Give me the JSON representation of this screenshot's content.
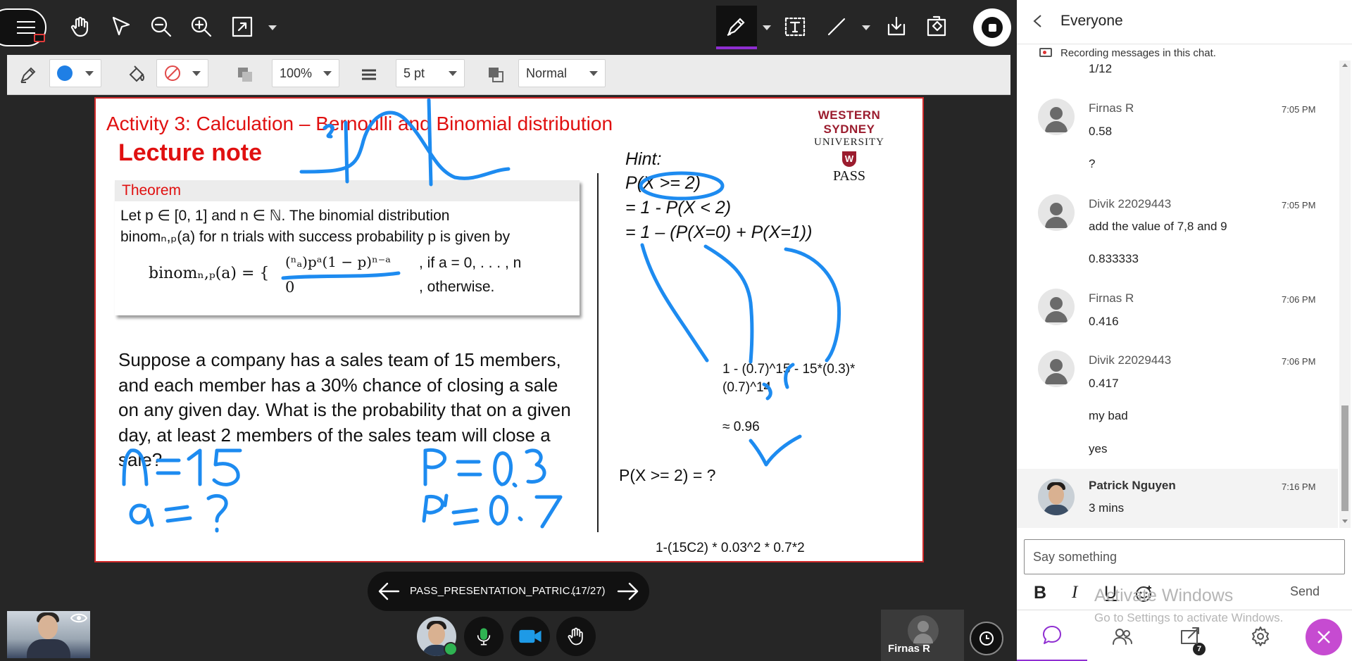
{
  "slide": {
    "title": "Activity 3: Calculation – Bernoulli and Binomial distribution",
    "lecture_note": "Lecture note",
    "logo": {
      "line1": "WESTERN SYDNEY",
      "line2": "UNIVERSITY",
      "shield": "W",
      "line3": "PASS"
    },
    "theorem": {
      "label": "Theorem",
      "line1": "Let p ∈ [0, 1] and n ∈ ℕ.  The binomial distribution",
      "line2": "binomₙ,ₚ(a) for n trials with success probability p is given by",
      "lhs": "binomₙ,ₚ(a) = {",
      "case1_formula": "(ⁿₐ)pᵃ(1 − p)ⁿ⁻ᵃ",
      "case1_cond": ", if a = 0, . . . , n",
      "case2_value": "0",
      "case2_cond": ", otherwise."
    },
    "problem": "Suppose a company has a sales team of 15 members, and each member has a 30% chance of closing a sale on any given day. What is the probability that on a given day, at least 2 members of the sales team will close a sale?",
    "hint": {
      "label": "Hint:",
      "line1": "P(X >= 2)",
      "line2": "= 1 - P(X < 2)",
      "line3": "= 1 – (P(X=0) + P(X=1))"
    },
    "calc_line1": "1 - (0.7)^15 - 15*(0.3)*",
    "calc_line2": "(0.7)^14",
    "approx": "≈ 0.96",
    "question": "P(X >= 2) = ?",
    "bottom_formula": "1-(15C2) * 0.03^2 * 0.7*2"
  },
  "toolbar": {
    "zoom": "100%",
    "line_width": "5 pt",
    "blend_mode": "Normal",
    "stroke_color": "#1f7fe5"
  },
  "presentation": {
    "file_name": "PASS_PRESENTATION_PATRIC...",
    "page": "(17/27)"
  },
  "participant_tile": {
    "name": "Firnas R"
  },
  "chat": {
    "title": "Everyone",
    "recording_notice": "Recording messages in this chat.",
    "messages": [
      {
        "text": "1/12"
      },
      {
        "name": "Firnas R",
        "time": "7:05 PM",
        "lines": [
          "0.58",
          "?"
        ]
      },
      {
        "name": "Divik 22029443",
        "time": "7:05 PM",
        "lines": [
          "add the value of 7,8 and 9",
          "0.833333"
        ]
      },
      {
        "name": "Firnas R",
        "time": "7:06 PM",
        "lines": [
          "0.416"
        ]
      },
      {
        "name": "Divik 22029443",
        "time": "7:06 PM",
        "lines": [
          "0.417",
          "my bad",
          "yes"
        ]
      },
      {
        "name": "Patrick Nguyen",
        "time": "7:16 PM",
        "lines": [
          "3 mins"
        ]
      }
    ],
    "input_placeholder": "Say something",
    "format": {
      "bold": "B",
      "italic": "I",
      "underline": "U"
    },
    "watermark_line1": "Activate Windows",
    "watermark_line2": "Go to Settings to activate Windows.",
    "send_label": "Send",
    "participants_count": "7"
  }
}
